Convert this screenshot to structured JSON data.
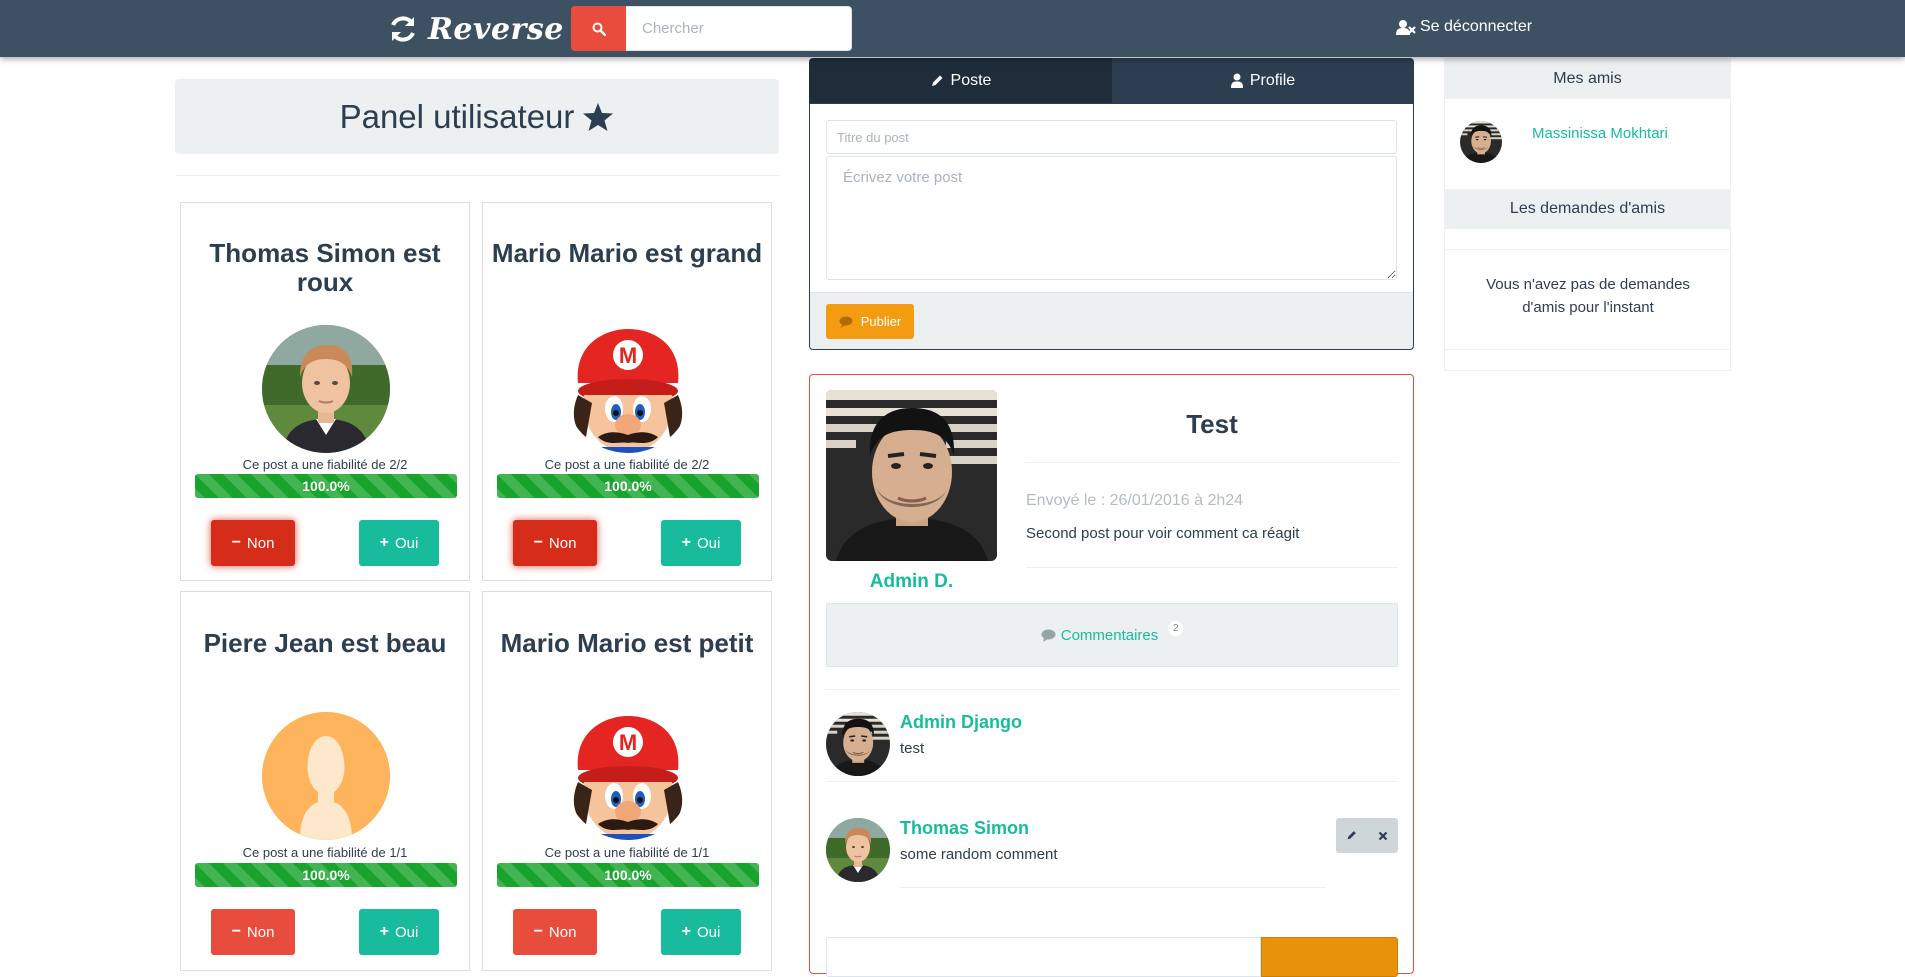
{
  "navbar": {
    "brand": "Reverse",
    "search_placeholder": "Chercher",
    "logout_label": "Se déconnecter"
  },
  "panel": {
    "title": "Panel utilisateur"
  },
  "cards": [
    {
      "title": "Thomas Simon est roux",
      "avatar": "photo-young-man",
      "fiabilite": "Ce post a une fiabilité de 2/2",
      "progress_label": "100.0%",
      "progress": 1.0,
      "non_label": "Non",
      "oui_label": "Oui",
      "non_active": true
    },
    {
      "title": "Mario Mario est grand",
      "avatar": "mario",
      "fiabilite": "Ce post a une fiabilité de 2/2",
      "progress_label": "100.0%",
      "progress": 1.0,
      "non_label": "Non",
      "oui_label": "Oui",
      "non_active": true
    },
    {
      "title": "Piere Jean est beau",
      "avatar": "default-silhouette",
      "fiabilite": "Ce post a une fiabilité de 1/1",
      "progress_label": "100.0%",
      "progress": 1.0,
      "non_label": "Non",
      "oui_label": "Oui",
      "non_active": false
    },
    {
      "title": "Mario Mario est petit",
      "avatar": "mario",
      "fiabilite": "Ce post a une fiabilité de 1/1",
      "progress_label": "100.0%",
      "progress": 1.0,
      "non_label": "Non",
      "oui_label": "Oui",
      "non_active": false
    }
  ],
  "tabs": [
    {
      "label": "Poste",
      "icon": "pencil-icon",
      "active": true
    },
    {
      "label": "Profile",
      "icon": "user-icon",
      "active": false
    }
  ],
  "post_form": {
    "title_placeholder": "Titre du post",
    "body_placeholder": "Écrivez votre post",
    "publish_label": "Publier"
  },
  "post": {
    "author": "Admin D.",
    "title": "Test",
    "date": "Envoyé le : 26/01/2016 à 2h24",
    "body": "Second post pour voir comment ca réagit",
    "comments_label": "Commentaires",
    "comments_count": "2",
    "comments": [
      {
        "name": "Admin Django",
        "text": "test",
        "editable": false
      },
      {
        "name": "Thomas Simon",
        "text": "some random comment",
        "editable": true
      }
    ]
  },
  "sidebar": {
    "friends_title": "Mes amis",
    "friends": [
      {
        "name": "Massinissa Mokhtari"
      }
    ],
    "requests_title": "Les demandes d'amis",
    "no_requests_text": "Vous n'avez pas de demandes d'amis pour l'instant"
  },
  "colors": {
    "navbar": "#3e5163",
    "danger": "#e74c3c",
    "success": "#18bc9c",
    "warning": "#f39c12",
    "progress": "#18a32c",
    "light": "#ecf0f1"
  }
}
